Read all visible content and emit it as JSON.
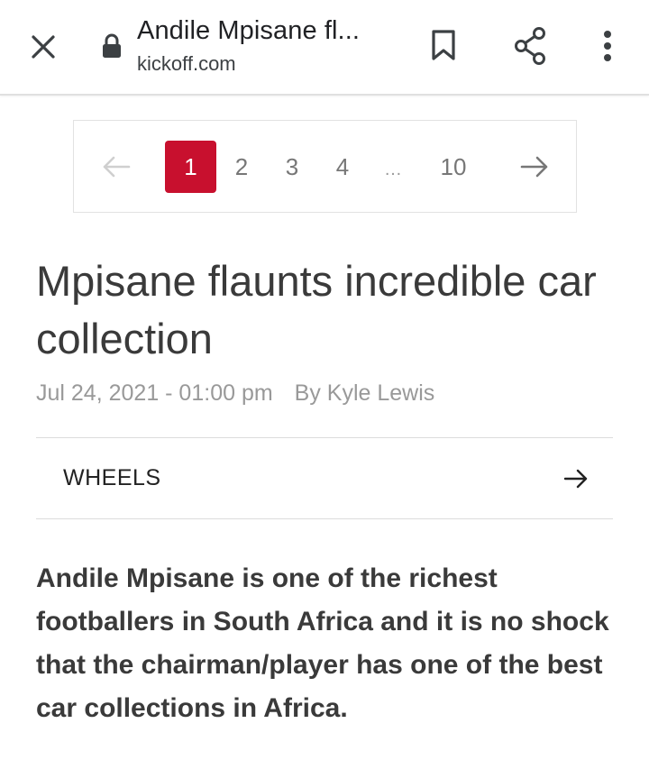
{
  "browser": {
    "page_title": "Andile Mpisane fl...",
    "domain": "kickoff.com",
    "icons": {
      "close": "close-icon",
      "lock": "lock-icon",
      "bookmark": "bookmark-icon",
      "share": "share-icon",
      "more": "more-vert-icon"
    }
  },
  "pagination": {
    "current": 1,
    "pages": [
      "1",
      "2",
      "3",
      "4",
      "…",
      "10"
    ],
    "prev_enabled": false,
    "next_enabled": true,
    "active_color": "#c8102e"
  },
  "article": {
    "headline": "Mpisane flaunts incredible car collection",
    "date": "Jul 24, 2021 - 01:00 pm",
    "author": "By Kyle Lewis",
    "category": "WHEELS",
    "lead": "Andile Mpisane is one of the richest footballers in South Africa and it is no shock that the chairman/player has one of the best car collections in Africa."
  }
}
